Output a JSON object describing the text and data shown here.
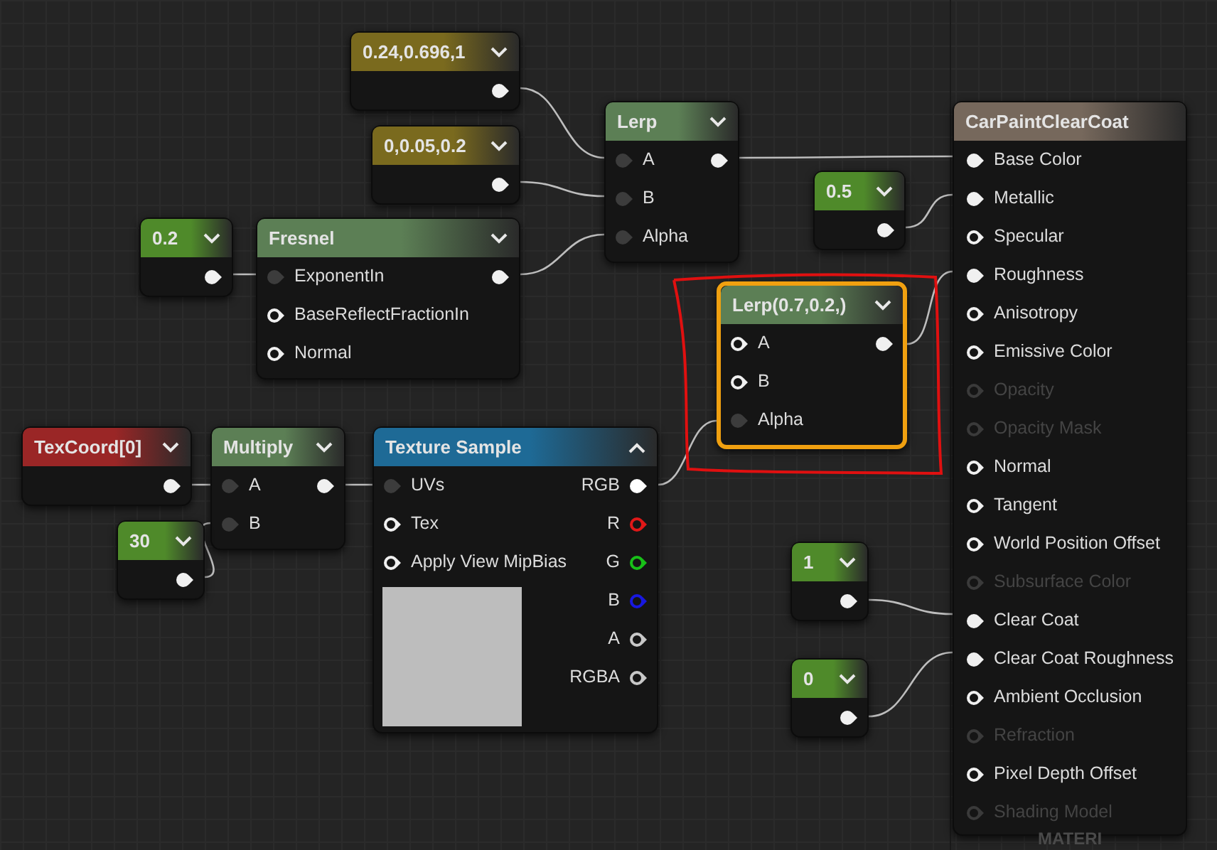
{
  "nodes": [
    {
      "kind": "constant",
      "title": "0.24,0.696,1",
      "color": "#7a6a1e",
      "selected": false,
      "expanded": false,
      "output": {
        "kind": "connected"
      }
    },
    {
      "kind": "constant",
      "title": "0,0.05,0.2",
      "color": "#7a6a1e",
      "selected": false,
      "expanded": false,
      "output": {
        "kind": "connected"
      }
    },
    {
      "kind": "constant",
      "title": "0.2",
      "color": "#4f8a2a",
      "selected": false,
      "expanded": false,
      "output": {
        "kind": "connected"
      }
    },
    {
      "kind": "function",
      "title": "Fresnel",
      "color": "#5c7f55",
      "selected": false,
      "expanded": false,
      "inputs": [
        {
          "label": "ExponentIn",
          "kind": "dark"
        },
        {
          "label": "BaseReflectFractionIn",
          "kind": "open"
        },
        {
          "label": "Normal",
          "kind": "open"
        }
      ],
      "outputs": [
        {
          "kind": "connected"
        }
      ]
    },
    {
      "kind": "function",
      "title": "Lerp",
      "color": "#5c7f55",
      "selected": false,
      "expanded": false,
      "inputs": [
        {
          "label": "A",
          "kind": "dark"
        },
        {
          "label": "B",
          "kind": "dark"
        },
        {
          "label": "Alpha",
          "kind": "dark"
        }
      ],
      "outputs": [
        {
          "kind": "connected"
        }
      ]
    },
    {
      "kind": "constant",
      "title": "0.5",
      "color": "#4f8a2a",
      "selected": false,
      "expanded": false,
      "output": {
        "kind": "connected"
      }
    },
    {
      "kind": "result",
      "title": "CarPaintClearCoat",
      "color": "#76685c",
      "selected": false,
      "inputs": [
        {
          "label": "Base Color",
          "kind": "connected",
          "disabled": false
        },
        {
          "label": "Metallic",
          "kind": "connected",
          "disabled": false
        },
        {
          "label": "Specular",
          "kind": "open",
          "disabled": false
        },
        {
          "label": "Roughness",
          "kind": "connected",
          "disabled": false
        },
        {
          "label": "Anisotropy",
          "kind": "open",
          "disabled": false
        },
        {
          "label": "Emissive Color",
          "kind": "open",
          "disabled": false
        },
        {
          "label": "Opacity",
          "kind": "open",
          "disabled": true
        },
        {
          "label": "Opacity Mask",
          "kind": "open",
          "disabled": true
        },
        {
          "label": "Normal",
          "kind": "open",
          "disabled": false
        },
        {
          "label": "Tangent",
          "kind": "open",
          "disabled": false
        },
        {
          "label": "World Position Offset",
          "kind": "open",
          "disabled": false
        },
        {
          "label": "Subsurface Color",
          "kind": "open",
          "disabled": true
        },
        {
          "label": "Clear Coat",
          "kind": "connected",
          "disabled": false
        },
        {
          "label": "Clear Coat Roughness",
          "kind": "connected",
          "disabled": false
        },
        {
          "label": "Ambient Occlusion",
          "kind": "open",
          "disabled": false
        },
        {
          "label": "Refraction",
          "kind": "open",
          "disabled": true
        },
        {
          "label": "Pixel Depth Offset",
          "kind": "open",
          "disabled": false
        },
        {
          "label": "Shading Model",
          "kind": "open",
          "disabled": true
        }
      ]
    },
    {
      "kind": "function",
      "title": "Lerp(0.7,0.2,)",
      "color": "#5c7f55",
      "selected": true,
      "expanded": false,
      "inputs": [
        {
          "label": "A",
          "kind": "open"
        },
        {
          "label": "B",
          "kind": "open"
        },
        {
          "label": "Alpha",
          "kind": "dark"
        }
      ],
      "outputs": [
        {
          "kind": "connected"
        }
      ]
    },
    {
      "kind": "constant",
      "title": "TexCoord[0]",
      "color": "#9a2626",
      "selected": false,
      "expanded": false,
      "output": {
        "kind": "connected"
      }
    },
    {
      "kind": "function",
      "title": "Multiply",
      "color": "#5c7f55",
      "selected": false,
      "expanded": false,
      "inputs": [
        {
          "label": "A",
          "kind": "dark"
        },
        {
          "label": "B",
          "kind": "dark"
        }
      ],
      "outputs": [
        {
          "kind": "connected"
        }
      ]
    },
    {
      "kind": "constant",
      "title": "30",
      "color": "#4f8a2a",
      "selected": false,
      "expanded": false,
      "output": {
        "kind": "connected"
      }
    },
    {
      "kind": "texture",
      "title": "Texture Sample",
      "color": "#1e6a96",
      "selected": false,
      "expanded": true,
      "inputs": [
        {
          "label": "UVs",
          "kind": "dark"
        },
        {
          "label": "Tex",
          "kind": "open"
        },
        {
          "label": "Apply View MipBias",
          "kind": "open"
        }
      ],
      "outputs": [
        {
          "label": "RGB",
          "kind": "connected",
          "color": "#ffffff"
        },
        {
          "label": "R",
          "kind": "open",
          "color": "#e01818"
        },
        {
          "label": "G",
          "kind": "open",
          "color": "#18c018"
        },
        {
          "label": "B",
          "kind": "open",
          "color": "#1818e0"
        },
        {
          "label": "A",
          "kind": "open",
          "color": "#c8c8c8"
        },
        {
          "label": "RGBA",
          "kind": "open",
          "color": "#c8c8c8"
        }
      ]
    },
    {
      "kind": "constant",
      "title": "1",
      "color": "#4f8a2a",
      "selected": false,
      "expanded": false,
      "output": {
        "kind": "connected"
      }
    },
    {
      "kind": "constant",
      "title": "0",
      "color": "#4f8a2a",
      "selected": false,
      "expanded": false,
      "output": {
        "kind": "connected"
      }
    }
  ],
  "graph_label": "MATERI"
}
